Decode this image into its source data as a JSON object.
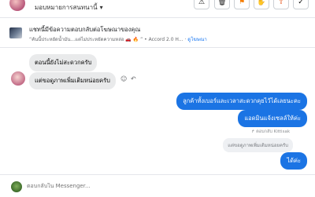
{
  "header": {
    "assignee_label": "มอบหมายการสนทนานี้",
    "dropdown_icon": "caret-down-icon",
    "toolbar_icons": [
      "alert-icon",
      "trash-icon",
      "flag-icon",
      "spam-icon",
      "folder-move-icon",
      "check-icon"
    ],
    "toolbar_glyphs": [
      "⚠",
      "🗑",
      "⚑",
      "✋",
      "⇪",
      "✓"
    ],
    "toolbar_colors": [
      "#1c1e21",
      "#1c1e21",
      "#f57c00",
      "#1c1e21",
      "#e85d26",
      "#1c1e21"
    ]
  },
  "ad": {
    "title": "แชทนี้มีข้อความตอบกลับต่อโฆษณาของคุณ",
    "subtitle": "“คันนี้ประหยัดน้ำมัน...แต่ไม่ประหยัดความหล่อ 🚗 🔥 ” • Accord 2.0 H...",
    "link": "ดูโฆษณา"
  },
  "messages": {
    "in_1": "ตอนนี้ยังไม่สะดวกครับ",
    "in_2": "แต่ขอดูภาพเพิ่มเติมหน่อยครับ",
    "out_1": "ลูกค้าทั้งเบอร์และเวลาสะดวกคุยไว้ได้เลยนะคะ",
    "out_2": "แอดมินแจ้งเซลล์ให้ค่ะ",
    "reply_meta": "ตอบกลับ Kittisak",
    "quoted": "แต่ขอดูภาพเพิ่มเติมหน่อยครับ",
    "out_3": "ได้ค่ะ"
  },
  "composer": {
    "placeholder": "ตอบกลับใน Messenger..."
  },
  "colors": {
    "outgoing_bubble": "#1b74e4",
    "incoming_bubble": "#e9eaeb",
    "link": "#1877f2"
  }
}
